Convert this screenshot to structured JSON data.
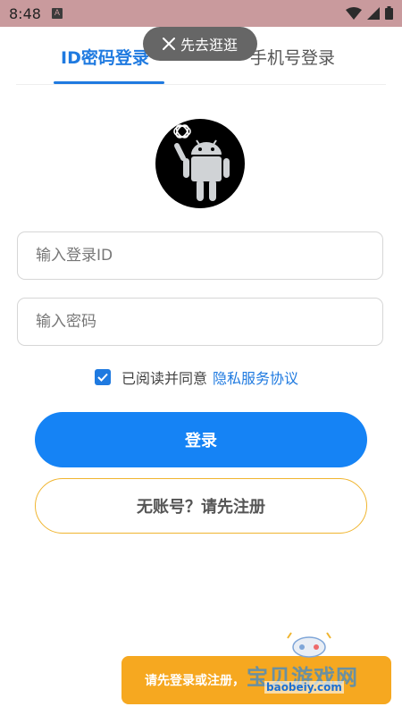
{
  "status_bar": {
    "time": "8:48",
    "app_icon": "A"
  },
  "tabs": [
    {
      "label": "ID密码登录",
      "active": true
    },
    {
      "label": "手机号登录",
      "active": false
    }
  ],
  "toast": {
    "label": "先去逛逛",
    "icon": "close-icon"
  },
  "form": {
    "id_placeholder": "输入登录ID",
    "password_placeholder": "输入密码",
    "agreement_text": "已阅读并同意",
    "agreement_link": "隐私服务协议",
    "agreement_checked": true
  },
  "buttons": {
    "login": "登录",
    "register": "无账号？请先注册"
  },
  "banner": {
    "text": "请先登录或注册，"
  },
  "watermark": {
    "title": "宝贝游戏网",
    "url": "baobeiy.com"
  },
  "colors": {
    "accent": "#1f7ae0",
    "login_button": "#1583f5",
    "banner": "#f6a820",
    "register_border": "#f0b52f",
    "status_bar": "#c99a9d"
  }
}
